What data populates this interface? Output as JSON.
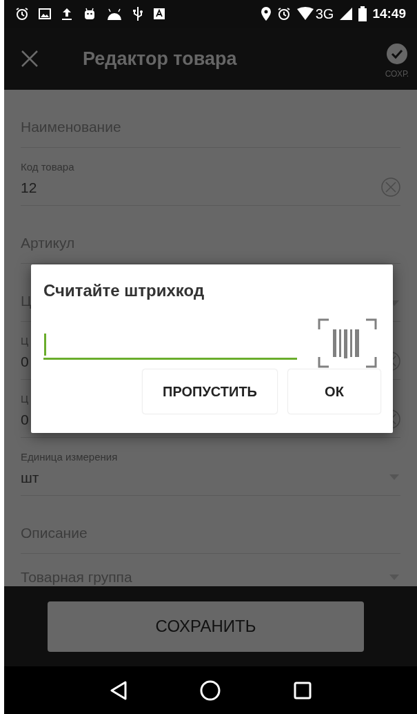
{
  "status_bar": {
    "network": "3G",
    "time": "14:49"
  },
  "app_bar": {
    "title": "Редактор товара",
    "save_label": "СОХР."
  },
  "fields": [
    {
      "kind": "text",
      "placeholder": "Наименование"
    },
    {
      "kind": "text",
      "label": "Код товара",
      "value": "12",
      "clearable": true
    },
    {
      "kind": "text",
      "placeholder": "Артикул"
    },
    {
      "kind": "dropdown",
      "placeholder": "Ц"
    },
    {
      "kind": "text",
      "label": "Ц",
      "value": "0",
      "clearable": true
    },
    {
      "kind": "text",
      "label": "Ц",
      "value": "0",
      "clearable": true
    },
    {
      "kind": "dropdown",
      "label": "Единица измерения",
      "value": "шт"
    },
    {
      "kind": "text",
      "placeholder": "Описание"
    },
    {
      "kind": "dropdown",
      "placeholder": "Товарная группа"
    }
  ],
  "dialog": {
    "title": "Считайте штрихкод",
    "buttons": [
      "ПРОПУСТИТЬ",
      "ОК"
    ]
  },
  "save_button": "СОХРАНИТЬ"
}
